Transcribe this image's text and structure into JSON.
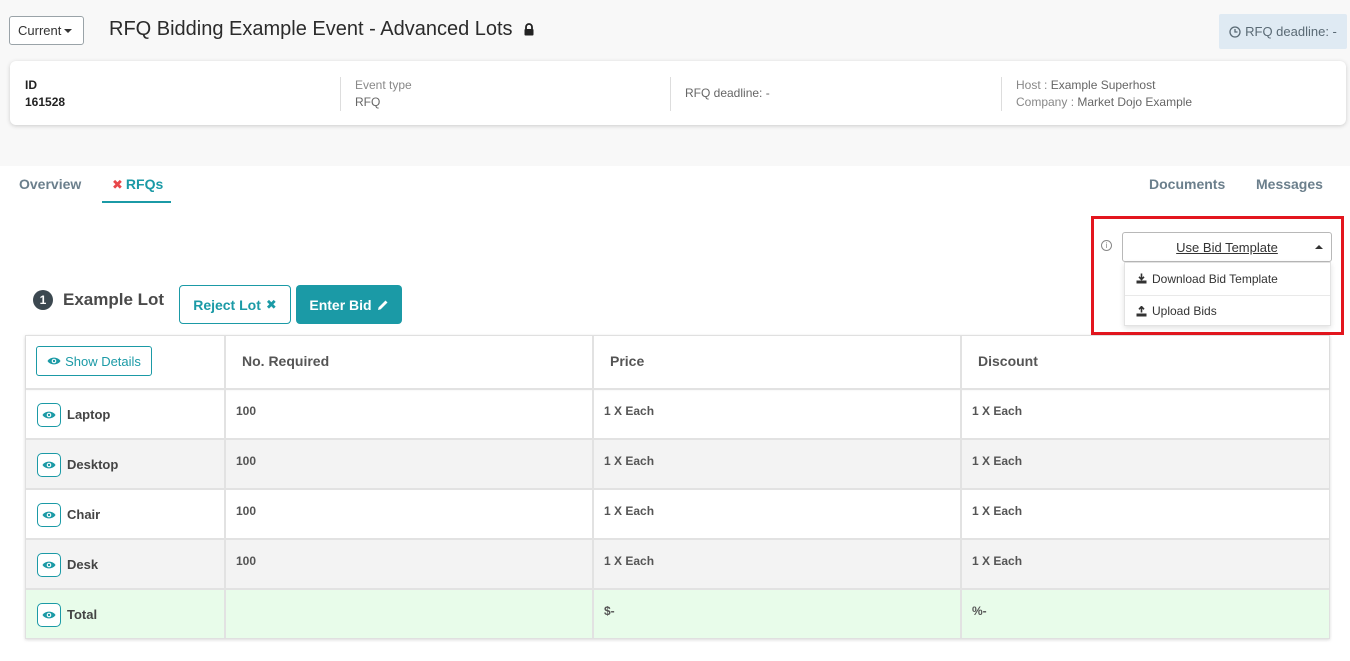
{
  "header": {
    "version_label": "Current",
    "title": "RFQ Bidding Example Event - Advanced Lots",
    "deadline_badge": "RFQ deadline: -"
  },
  "info_card": {
    "id_label": "ID",
    "id_value": "161528",
    "event_type_label": "Event type",
    "event_type_value": "RFQ",
    "deadline": "RFQ deadline: -",
    "host_label": "Host :",
    "host_value": "Example Superhost",
    "company_label": "Company :",
    "company_value": "Market Dojo Example"
  },
  "tabs": {
    "overview": "Overview",
    "rfqs": "RFQs",
    "documents": "Documents",
    "messages": "Messages"
  },
  "bid_template": {
    "toggle_label": "Use Bid Template",
    "items": [
      "Download Bid Template",
      "Upload Bids"
    ]
  },
  "lot": {
    "number": "1",
    "name": "Example Lot",
    "reject_label": "Reject Lot",
    "enter_bid_label": "Enter Bid"
  },
  "table": {
    "show_details_label": "Show Details",
    "headers": [
      "No. Required",
      "Price",
      "Discount"
    ],
    "rows": [
      {
        "name": "Laptop",
        "required": "100",
        "price": "1 X Each",
        "discount": "1 X Each"
      },
      {
        "name": "Desktop",
        "required": "100",
        "price": "1 X Each",
        "discount": "1 X Each"
      },
      {
        "name": "Chair",
        "required": "100",
        "price": "1 X Each",
        "discount": "1 X Each"
      },
      {
        "name": "Desk",
        "required": "100",
        "price": "1 X Each",
        "discount": "1 X Each"
      }
    ],
    "total": {
      "name": "Total",
      "required": "",
      "price": "$-",
      "discount": "%-"
    }
  },
  "colors": {
    "accent": "#1b9aa6",
    "highlight": "#e3161e",
    "total_row": "#e8fcea"
  }
}
